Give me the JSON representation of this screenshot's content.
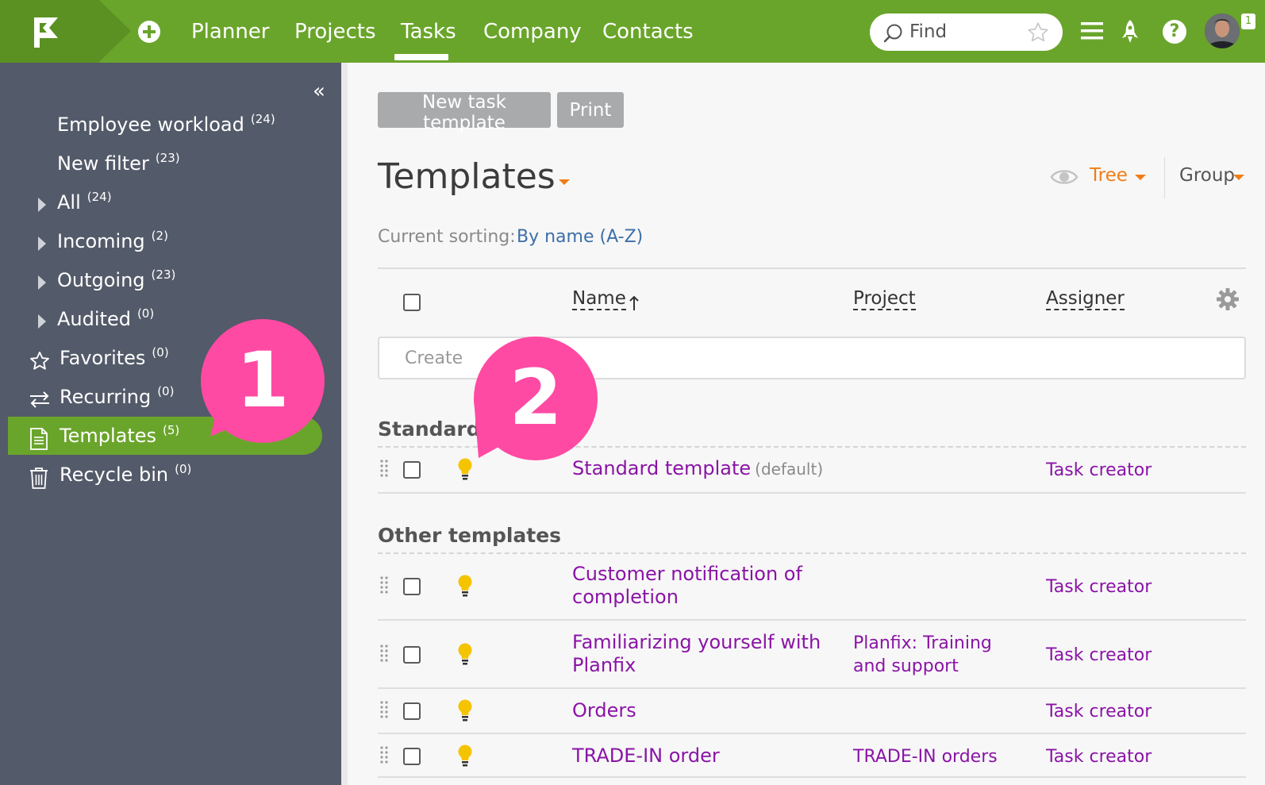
{
  "topbar": {
    "nav": [
      "Planner",
      "Projects",
      "Tasks",
      "Company",
      "Contacts"
    ],
    "active_nav": "Tasks",
    "search_placeholder": "Find",
    "notification_count": "1",
    "help_glyph": "?"
  },
  "sidebar": {
    "collapse_glyph": "«",
    "items": [
      {
        "label": "Employee workload",
        "count": "(24)"
      },
      {
        "label": "New filter",
        "count": "(23)"
      },
      {
        "label": "All",
        "count": "(24)"
      },
      {
        "label": "Incoming",
        "count": "(2)"
      },
      {
        "label": "Outgoing",
        "count": "(23)"
      },
      {
        "label": "Audited",
        "count": "(0)"
      },
      {
        "label": "Favorites",
        "count": "(0)"
      },
      {
        "label": "Recurring",
        "count": "(0)"
      },
      {
        "label": "Templates",
        "count": "(5)"
      },
      {
        "label": "Recycle bin",
        "count": "(0)"
      }
    ],
    "active_item": "Templates"
  },
  "callouts": [
    "1",
    "2"
  ],
  "toolbar": {
    "new_template": "New task template",
    "print": "Print"
  },
  "main": {
    "title": "Templates",
    "view_mode": "Tree",
    "group_label": "Group",
    "sorting_label": "Current sorting:",
    "sorting_value": "By name (A-Z)",
    "columns": {
      "name": "Name",
      "project": "Project",
      "assigner": "Assigner"
    },
    "create_placeholder": "Create",
    "sections": [
      {
        "title": "Standard",
        "rows": [
          {
            "name": "Standard template",
            "suffix": "(default)",
            "project": "",
            "assigner": "Task creator"
          }
        ]
      },
      {
        "title": "Other templates",
        "rows": [
          {
            "name_line1": "Customer notification of",
            "name_line2": "completion",
            "project": "",
            "assigner": "Task creator"
          },
          {
            "name_line1": "Familiarizing yourself with",
            "name_line2": "Planfix",
            "project_line1": "Planfix: Training",
            "project_line2": "and support",
            "assigner": "Task creator"
          },
          {
            "name": "Orders",
            "project": "",
            "assigner": "Task creator"
          },
          {
            "name": "TRADE-IN order",
            "project": "TRADE-IN orders",
            "assigner": "Task creator"
          }
        ]
      }
    ]
  },
  "colors": {
    "brand_green": "#6aa52b",
    "sidebar_bg": "#535a69",
    "accent_orange": "#f07e16",
    "link_purple": "#8a14a6",
    "callout_pink": "#ff4aa3",
    "bulb_yellow": "#f5c400"
  },
  "icons": [
    "app-logo-icon",
    "plus-circle-icon",
    "search-icon",
    "star-icon",
    "hamburger-icon",
    "rocket-icon",
    "help-icon",
    "star-outline-icon",
    "recurring-icon",
    "template-doc-icon",
    "trash-icon",
    "eye-icon",
    "sort-up-icon",
    "gear-icon",
    "drag-handle-icon",
    "lightbulb-icon"
  ]
}
